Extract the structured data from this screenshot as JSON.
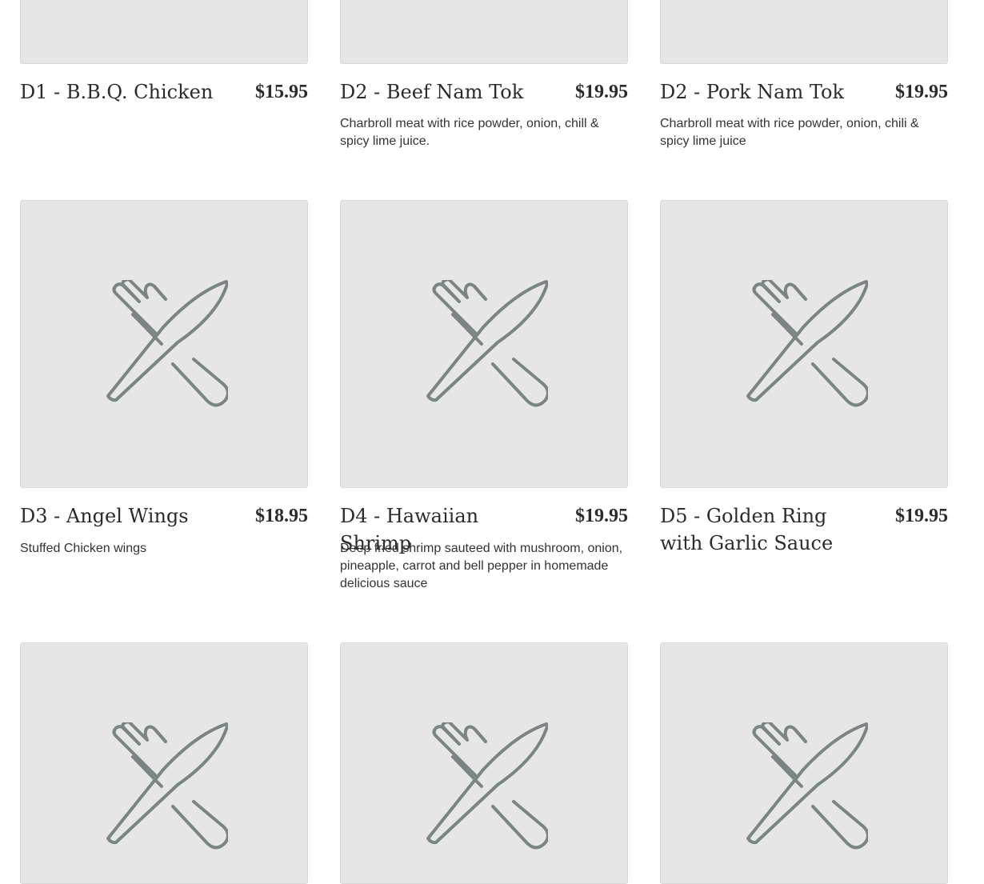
{
  "menu_items": [
    {
      "name": "D1 - B.B.Q. Chicken",
      "price": "$15.95",
      "description": ""
    },
    {
      "name": "D2 - Beef Nam Tok",
      "price": "$19.95",
      "description": "Charbroll meat with rice powder, onion, chill & spicy lime juice."
    },
    {
      "name": "D2 - Pork Nam Tok",
      "price": "$19.95",
      "description": "Charbroll meat with rice powder, onion, chili & spicy lime juice"
    },
    {
      "name": "D3 - Angel Wings",
      "price": "$18.95",
      "description": "Stuffed Chicken wings"
    },
    {
      "name": "D4 - Hawaiian Shrimp",
      "price": "$19.95",
      "description": "Deep fried shrimp sauteed with mushroom, onion, pineapple, carrot and bell pepper in homemade delicious sauce"
    },
    {
      "name": "D5 - Golden Ring with Garlic Sauce",
      "price": "$19.95",
      "description": ""
    }
  ],
  "placeholder_icon": "fork-knife-icon",
  "colors": {
    "placeholder_bg": "#e6e6e6",
    "icon_stroke": "#7a8484",
    "text": "#2b2b2b"
  }
}
